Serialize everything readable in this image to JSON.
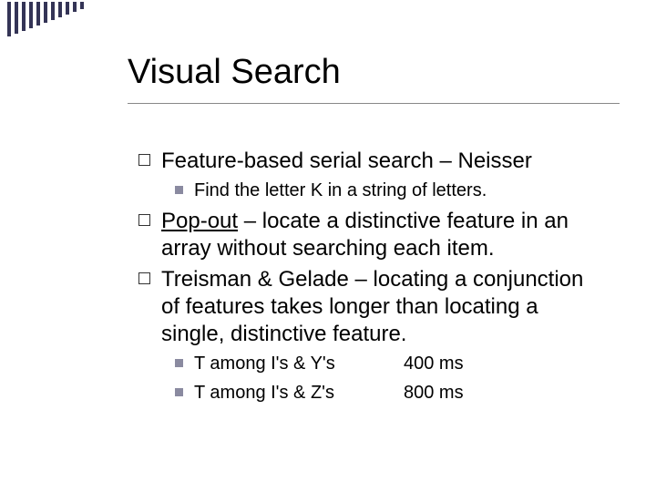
{
  "title": "Visual Search",
  "items": {
    "serial": {
      "text": "Feature-based serial search – Neisser",
      "sub": "Find the letter K in a string of letters."
    },
    "popout": {
      "term": "Pop-out",
      "rest": " – locate a distinctive feature in an array without searching each item."
    },
    "treisman": {
      "text": "Treisman & Gelade – locating a conjunction of features takes longer than locating a single, distinctive feature.",
      "timings": [
        {
          "stim": "T among I's & Y's",
          "ms": "400 ms"
        },
        {
          "stim": "T among I's & Z's",
          "ms": "800 ms"
        }
      ]
    }
  }
}
